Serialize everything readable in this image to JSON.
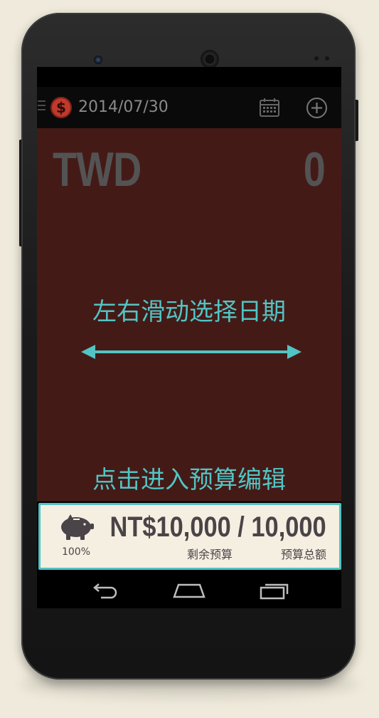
{
  "action_bar": {
    "menu_icon": "menu-icon",
    "logo_glyph": "$",
    "date": "2014/07/30",
    "calendar_icon": "calendar-icon",
    "add_icon": "add-circle-icon"
  },
  "main": {
    "currency_code": "TWD",
    "amount": "0",
    "swipe_hint": "左右滑动选择日期",
    "edit_hint": "点击进入预算编辑"
  },
  "budget": {
    "percent": "100%",
    "remaining": "NT$10,000",
    "separator": "/",
    "total": "10,000",
    "remaining_label": "剩余预算",
    "total_label": "预算总额"
  },
  "nav": {
    "back_icon": "back-icon",
    "home_icon": "home-icon",
    "recents_icon": "recents-icon"
  },
  "colors": {
    "accent": "#52c4c4",
    "main_bg": "#441a17",
    "panel_bg": "#f4efe1",
    "logo_red": "#c0392b"
  }
}
